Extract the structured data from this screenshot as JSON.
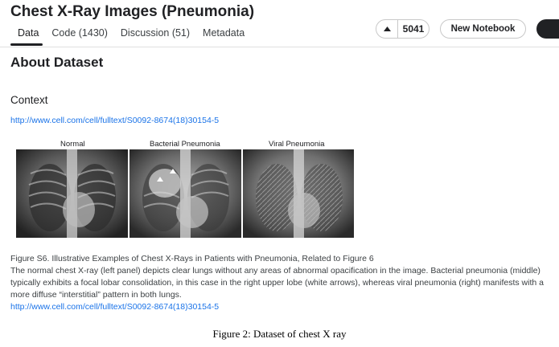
{
  "header": {
    "title": "Chest X-Ray Images (Pneumonia)",
    "tabs": [
      {
        "label": "Data"
      },
      {
        "label": "Code (1430)"
      },
      {
        "label": "Discussion (51)"
      },
      {
        "label": "Metadata"
      }
    ],
    "vote_count": "5041",
    "new_notebook_label": "New Notebook",
    "icons": {
      "upvote": "triangle-up-icon"
    }
  },
  "main": {
    "section_title": "About Dataset",
    "context_heading": "Context",
    "context_link": "http://www.cell.com/cell/fulltext/S0092-8674(18)30154-5",
    "figure": {
      "panel_labels": [
        "Normal",
        "Bacterial Pneumonia",
        "Viral Pneumonia"
      ]
    },
    "caption_title": "Figure S6. Illustrative Examples of Chest X-Rays in Patients with Pneumonia, Related to Figure 6",
    "caption_body": "The normal chest X-ray (left panel) depicts clear lungs without any areas of abnormal opacification in the image. Bacterial pneumonia (middle) typically exhibits a focal lobar consolidation, in this case in the right upper lobe (white arrows), whereas viral pneumonia (right) manifests with a more diffuse “interstitial” pattern in both lungs.",
    "caption_link": "http://www.cell.com/cell/fulltext/S0092-8674(18)30154-5"
  },
  "figure_caption": "Figure 2: Dataset of chest X ray"
}
